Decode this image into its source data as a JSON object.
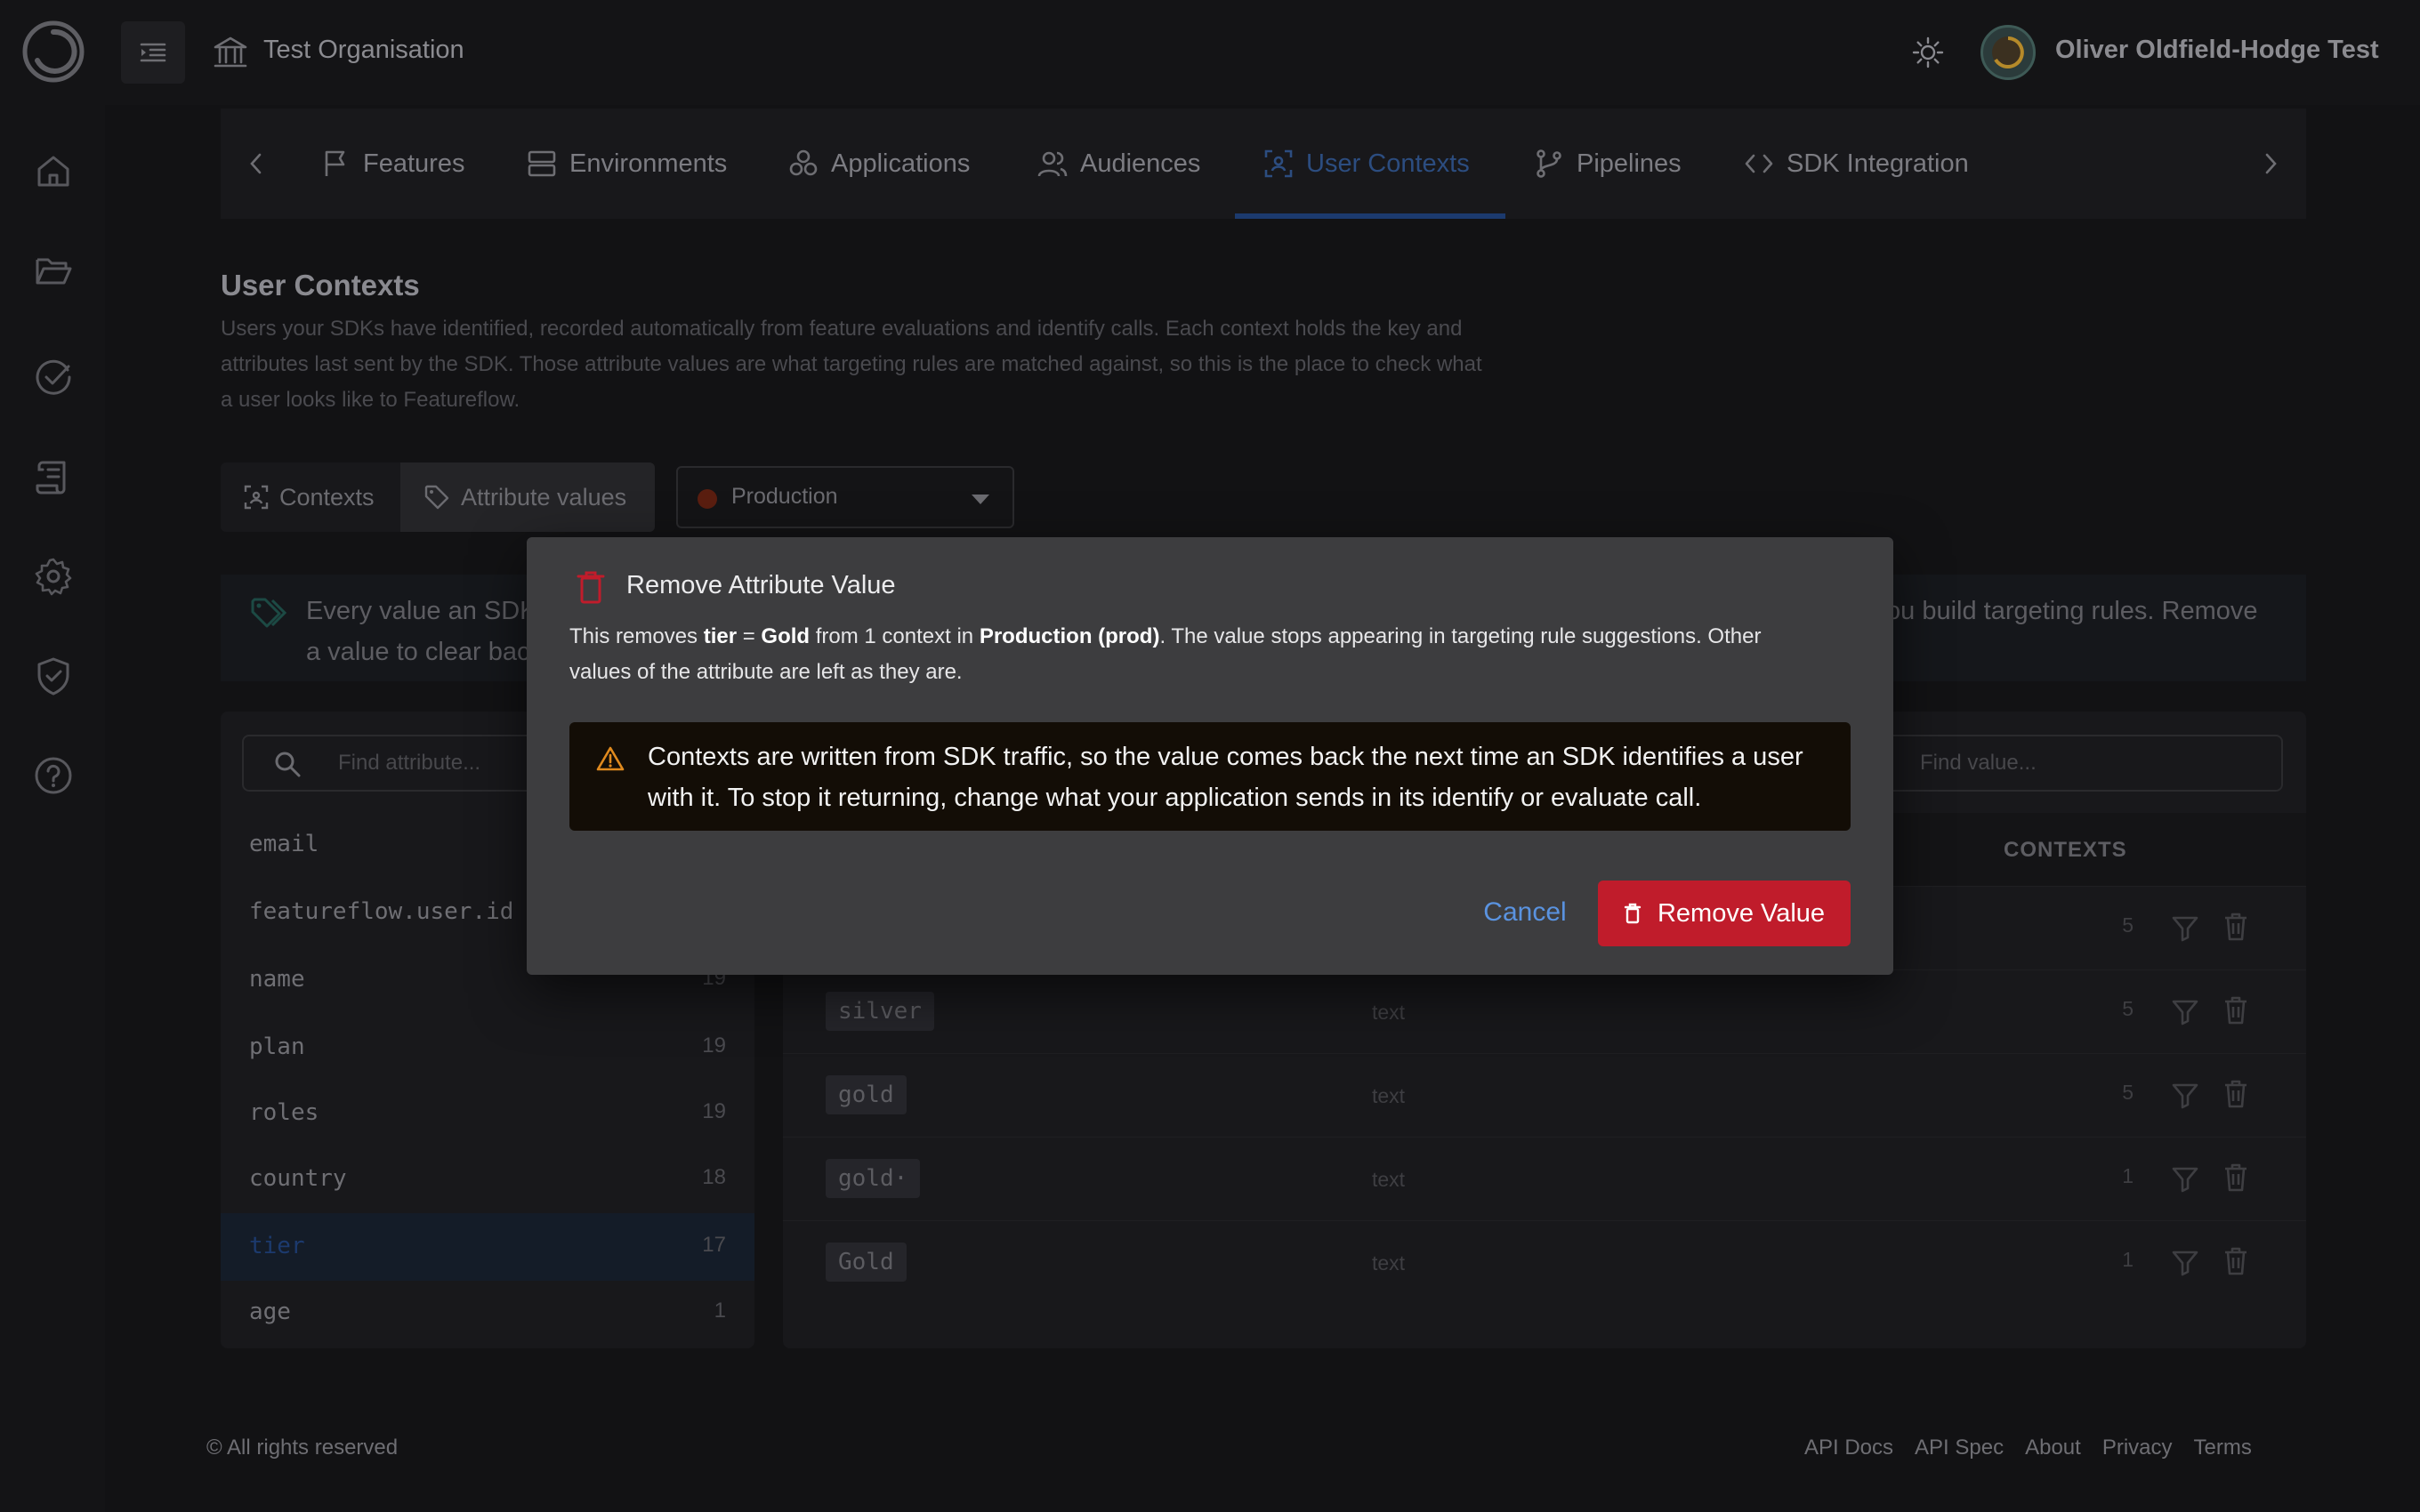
{
  "header": {
    "org_name": "Test Organisation",
    "user_name": "Oliver Oldfield-Hodge Test"
  },
  "tabs": [
    {
      "label": "Features"
    },
    {
      "label": "Environments"
    },
    {
      "label": "Applications"
    },
    {
      "label": "Audiences"
    },
    {
      "label": "User Contexts",
      "active": true
    },
    {
      "label": "Pipelines"
    },
    {
      "label": "SDK Integration"
    }
  ],
  "page": {
    "title": "User Contexts",
    "description": "Users your SDKs have identified, recorded automatically from feature evaluations and identify calls. Each context holds the key and attributes last sent by the SDK. Those attribute values are what targeting rules are matched against, so this is the place to check what a user looks like to Featureflow."
  },
  "view_toggle": {
    "contexts_label": "Contexts",
    "attribute_values_label": "Attribute values",
    "selected": "Attribute values"
  },
  "environment_select": {
    "value": "Production",
    "dot_color": "#5a1e10"
  },
  "info_banner": {
    "left_text": "Every value an SDK a value to clear bac",
    "right_text": "ou build targeting rules. Remove"
  },
  "attributes": {
    "search_placeholder": "Find attribute...",
    "items": [
      {
        "key": "email",
        "count": ""
      },
      {
        "key": "featureflow.user.id",
        "count": ""
      },
      {
        "key": "name",
        "count": "19"
      },
      {
        "key": "plan",
        "count": "19"
      },
      {
        "key": "roles",
        "count": "19"
      },
      {
        "key": "country",
        "count": "18"
      },
      {
        "key": "tier",
        "count": "17",
        "selected": true
      },
      {
        "key": "age",
        "count": "1"
      }
    ]
  },
  "values_table": {
    "search_placeholder": "Find value...",
    "contexts_header": "CONTEXTS",
    "rows": [
      {
        "value": "",
        "type": "",
        "contexts": "5"
      },
      {
        "value": "silver",
        "type": "text",
        "contexts": "5"
      },
      {
        "value": "gold",
        "type": "text",
        "contexts": "5"
      },
      {
        "value": "gold·",
        "type": "text",
        "contexts": "1"
      },
      {
        "value": "Gold",
        "type": "text",
        "contexts": "1"
      }
    ]
  },
  "footer": {
    "copyright": "© All rights reserved",
    "links": [
      "API Docs",
      "API Spec",
      "About",
      "Privacy",
      "Terms"
    ]
  },
  "modal": {
    "title": "Remove Attribute Value",
    "body_prefix": "This removes ",
    "attr_key": "tier",
    "equals": " = ",
    "attr_value": "Gold",
    "body_mid": " from 1 context in ",
    "environment": "Production (prod)",
    "body_suffix": ". The value stops appearing in targeting rule suggestions. Other values of the attribute are left as they are.",
    "warning": "Contexts are written from SDK traffic, so the value comes back the next time an SDK identifies a user with it. To stop it returning, change what your application sends in its identify or evaluate call.",
    "cancel_label": "Cancel",
    "remove_label": "Remove Value",
    "danger_color": "#c01c2b",
    "link_color": "#5a93e0"
  }
}
